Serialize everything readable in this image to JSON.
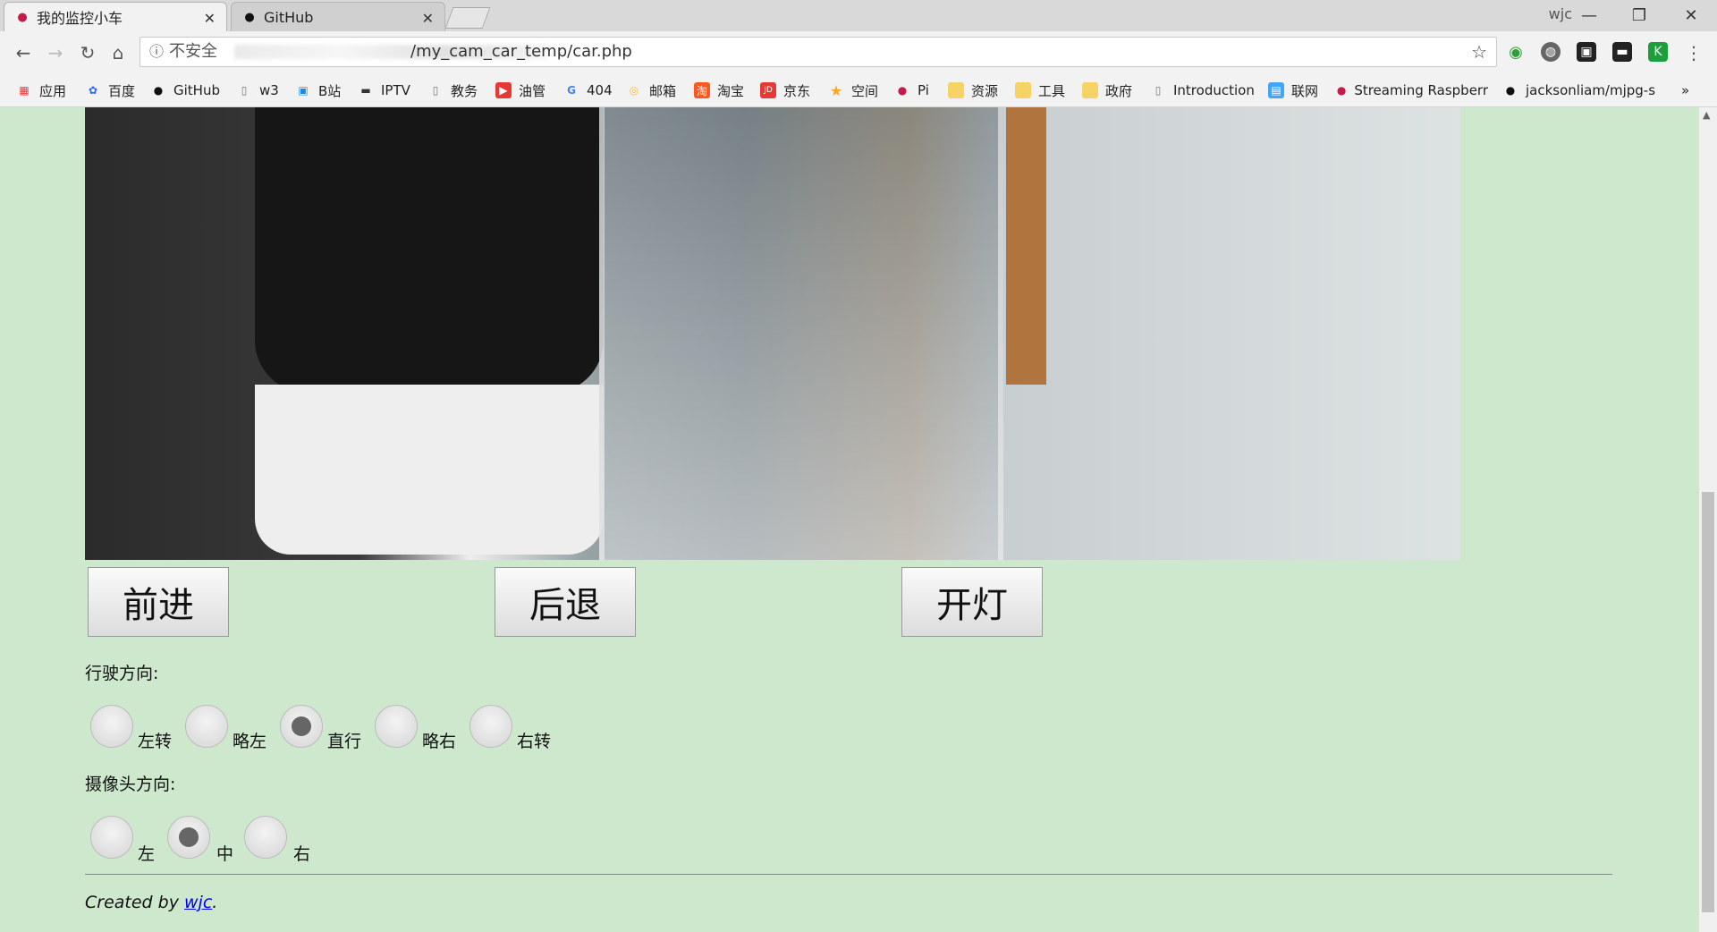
{
  "browser": {
    "tabs": [
      {
        "title": "我的监控小车",
        "icon": "raspberry-icon",
        "active": true
      },
      {
        "title": "GitHub",
        "icon": "github-icon",
        "active": false
      }
    ],
    "profile_name": "wjc",
    "address": {
      "security_label": "不安全",
      "url_path": "/my_cam_car_temp/car.php"
    },
    "bookmarks": [
      {
        "label": "应用",
        "icon": "apps-grid-icon"
      },
      {
        "label": "百度",
        "icon": "baidu-icon"
      },
      {
        "label": "GitHub",
        "icon": "github-icon"
      },
      {
        "label": "w3",
        "icon": "page-icon"
      },
      {
        "label": "B站",
        "icon": "bilibili-icon"
      },
      {
        "label": "IPTV",
        "icon": "tv-icon"
      },
      {
        "label": "教务",
        "icon": "page-icon"
      },
      {
        "label": "油管",
        "icon": "youtube-icon"
      },
      {
        "label": "404",
        "icon": "google-icon"
      },
      {
        "label": "邮箱",
        "icon": "chrome-icon"
      },
      {
        "label": "淘宝",
        "icon": "taobao-icon"
      },
      {
        "label": "京东",
        "icon": "jd-icon"
      },
      {
        "label": "空间",
        "icon": "star-icon"
      },
      {
        "label": "Pi",
        "icon": "raspberry-icon"
      },
      {
        "label": "资源",
        "icon": "folder-icon"
      },
      {
        "label": "工具",
        "icon": "folder-icon"
      },
      {
        "label": "政府",
        "icon": "folder-icon"
      },
      {
        "label": "Introduction",
        "icon": "page-icon"
      },
      {
        "label": "联网",
        "icon": "network-icon"
      },
      {
        "label": "Streaming Raspberr",
        "icon": "raspberry-icon"
      },
      {
        "label": "jacksonliam/mjpg-s",
        "icon": "github-icon"
      }
    ]
  },
  "page": {
    "buttons": {
      "forward": "前进",
      "backward": "后退",
      "light": "开灯"
    },
    "drive": {
      "label": "行驶方向:",
      "options": [
        "左转",
        "略左",
        "直行",
        "略右",
        "右转"
      ],
      "selected": "直行"
    },
    "camera": {
      "label": "摄像头方向:",
      "options": [
        "左",
        "中",
        "右"
      ],
      "selected": "中"
    },
    "footer": {
      "prefix": "Created by ",
      "author": "wjc",
      "suffix": "."
    }
  }
}
